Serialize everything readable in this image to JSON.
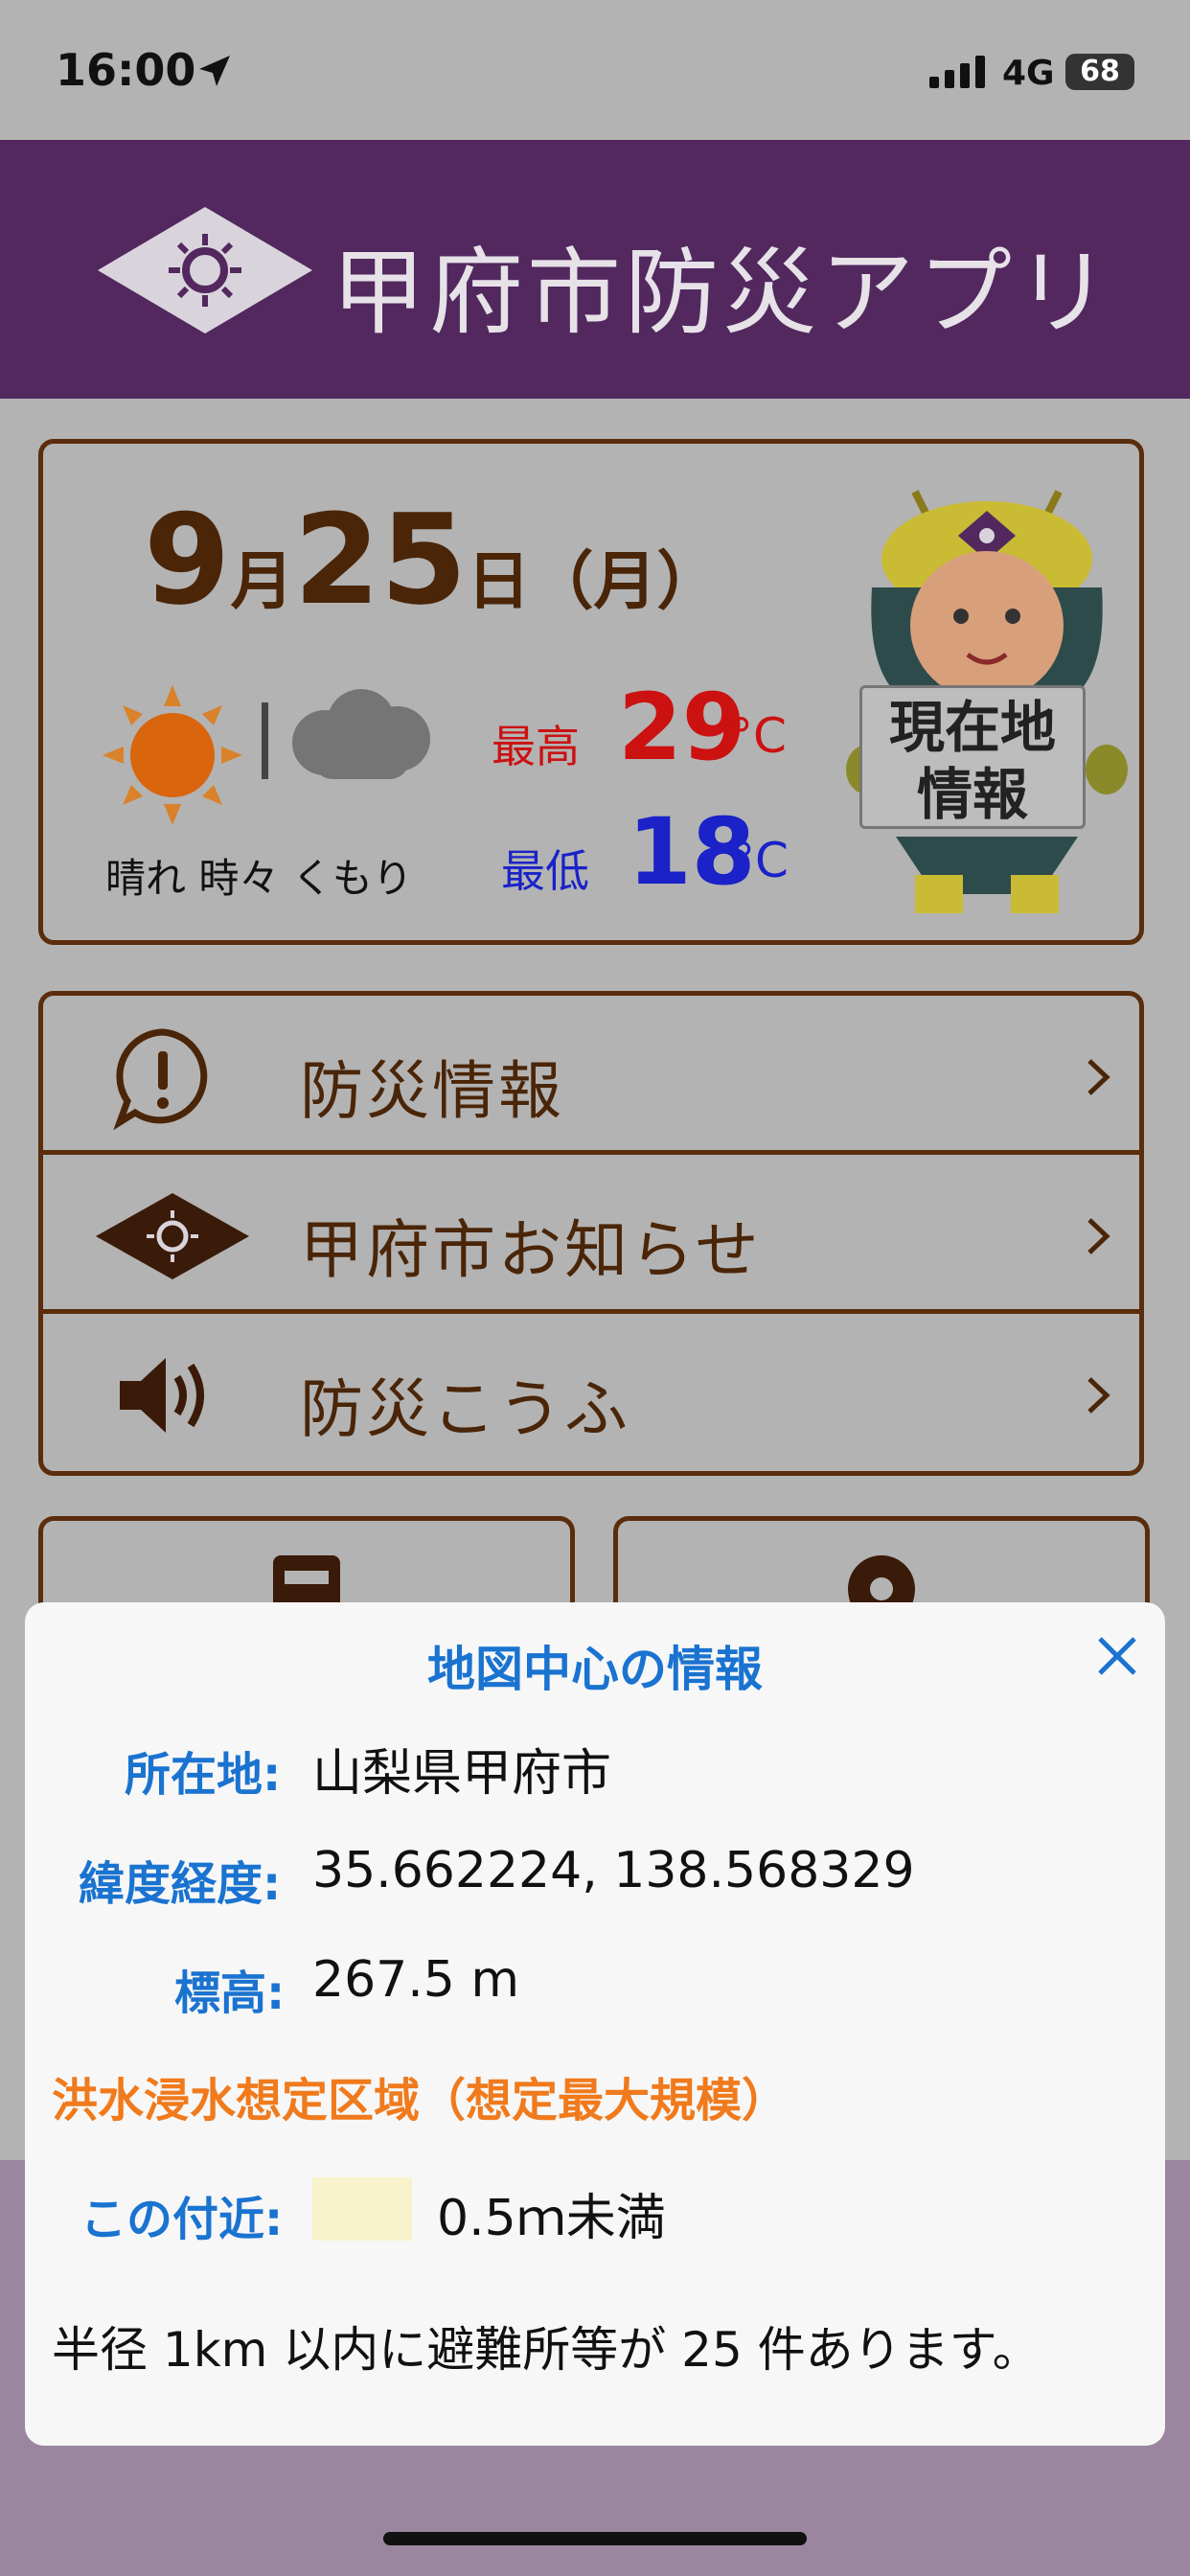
{
  "status_bar": {
    "time": "16:00",
    "network": "4G",
    "battery": "68"
  },
  "header": {
    "title": "甲府市防災アプリ"
  },
  "weather": {
    "date": {
      "month": "9",
      "month_unit": "月",
      "day": "25",
      "day_unit": "日",
      "weekday": "（月）"
    },
    "description": "晴れ 時々 くもり",
    "high_label": "最高",
    "high_value": "29",
    "high_unit": "°C",
    "low_label": "最低",
    "low_value": "18",
    "low_unit": "°C",
    "location_button_line1": "現在地",
    "location_button_line2": "情報"
  },
  "menu": [
    {
      "label": "防災情報",
      "icon": "alert-bubble-icon"
    },
    {
      "label": "甲府市お知らせ",
      "icon": "city-emblem-icon"
    },
    {
      "label": "防災こうふ",
      "icon": "speaker-icon"
    }
  ],
  "tiles": [
    {
      "icon": "document-icon"
    },
    {
      "icon": "map-pin-icon"
    }
  ],
  "popup": {
    "title": "地図中心の情報",
    "address_label": "所在地:",
    "address_value": "山梨県甲府市",
    "coords_label": "緯度経度:",
    "coords_value": "35.662224, 138.568329",
    "elevation_label": "標高:",
    "elevation_value": "267.5 m",
    "flood_heading": "洪水浸水想定区域（想定最大規模）",
    "nearby_label": "この付近:",
    "nearby_value": "0.5ｍ未満",
    "summary": "半径 1km 以内に避難所等が 25 件あります。"
  },
  "colors": {
    "header_purple": "#52285f",
    "brown": "#5a2d0c",
    "accent_blue": "#1a73d0",
    "flood_orange": "#f07a1c",
    "high_red": "#cc1111",
    "low_blue": "#1a22c8",
    "flood_swatch": "#f8f3cc"
  }
}
